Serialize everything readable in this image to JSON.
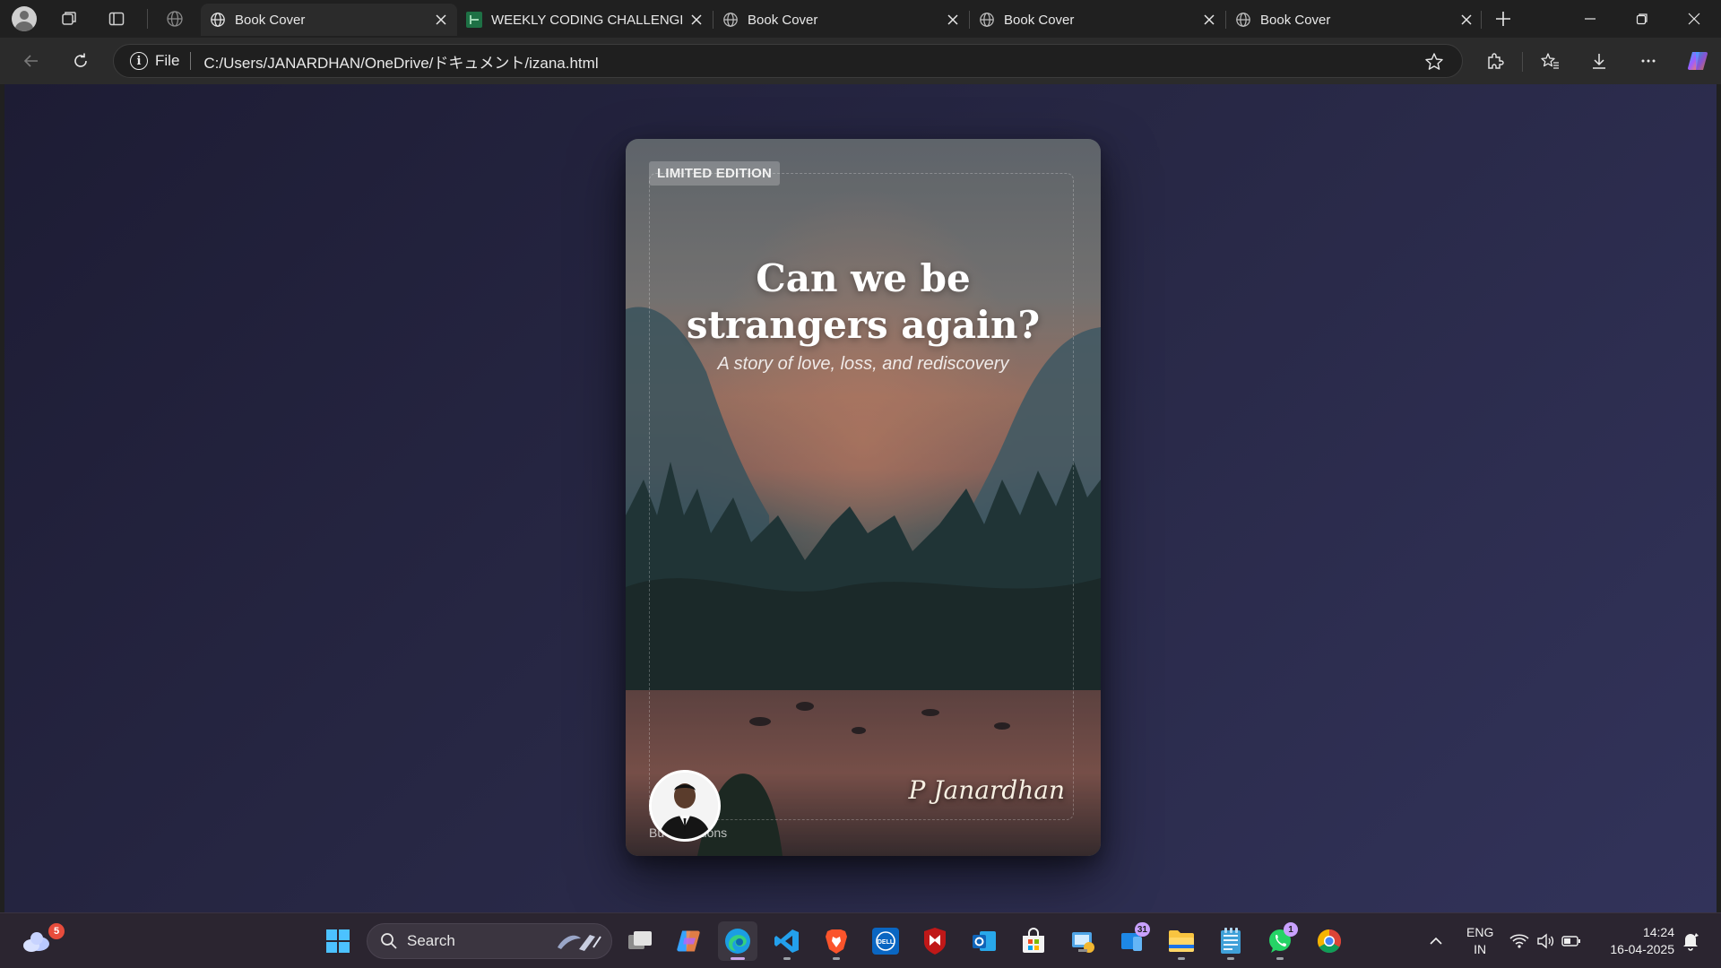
{
  "browser": {
    "tabs": [
      {
        "title": "Book Cover",
        "active": true,
        "icon": "globe-icon"
      },
      {
        "title": "WEEKLY CODING CHALLENGE -",
        "active": false,
        "icon": "spreadsheet-icon"
      },
      {
        "title": "Book Cover",
        "active": false,
        "icon": "globe-icon"
      },
      {
        "title": "Book Cover",
        "active": false,
        "icon": "globe-icon"
      },
      {
        "title": "Book Cover",
        "active": false,
        "icon": "globe-icon"
      }
    ],
    "address": {
      "scheme_label": "File",
      "url": "C:/Users/JANARDHAN/OneDrive/ドキュメント/izana.html"
    }
  },
  "book": {
    "badge": "LIMITED EDITION",
    "title_line1": "Can we be",
    "title_line2": "strangers again?",
    "subtitle": "A story of love, loss, and rediscovery",
    "publisher": "Bu        ublications",
    "signature": "P Janardhan"
  },
  "taskbar": {
    "weather_badge": "5",
    "search_label": "Search",
    "badges": {
      "teams": "31",
      "whatsapp": "1"
    },
    "language_line1": "ENG",
    "language_line2": "IN",
    "time": "14:24",
    "date": "16-04-2025"
  },
  "colors": {
    "accent": "#c8a6e6",
    "viewport_bg": "#272744",
    "chrome_bg": "#202020"
  }
}
